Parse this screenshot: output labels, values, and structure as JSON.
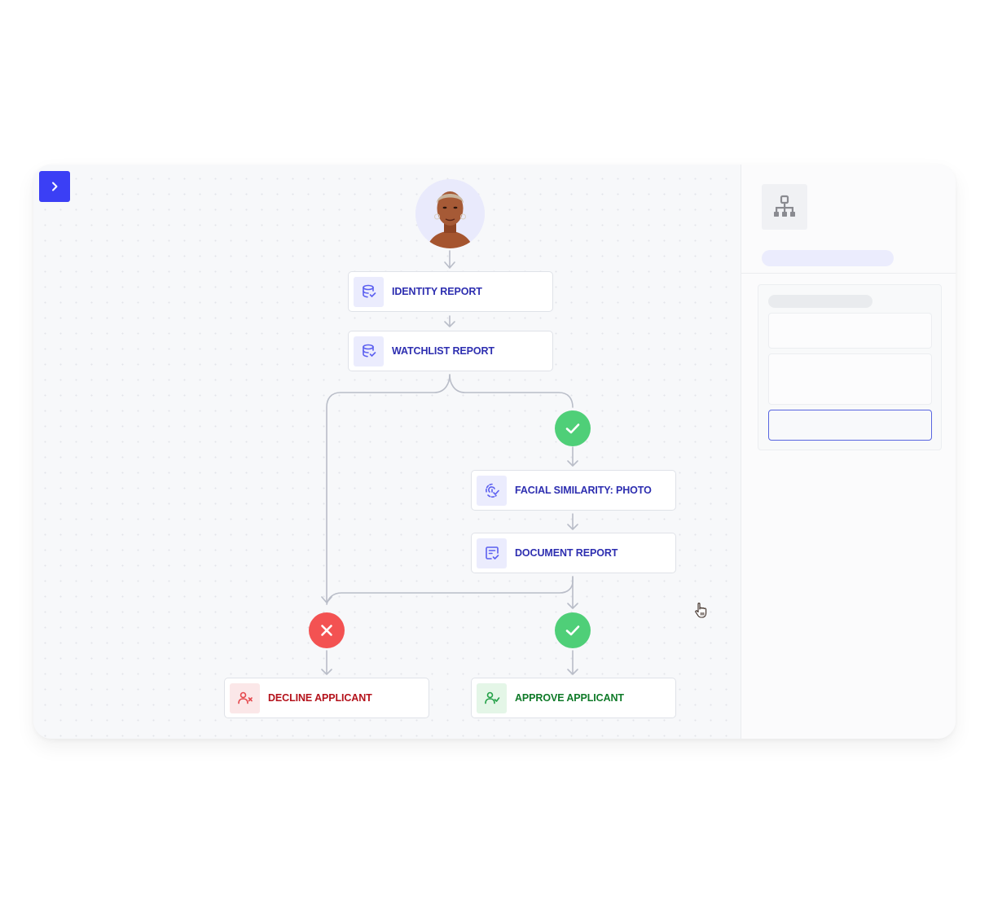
{
  "app": {
    "toggle_button": {
      "icon": "chevron-right-icon",
      "color": "#3b3ff5"
    }
  },
  "workflow": {
    "start": {
      "type": "applicant-avatar",
      "description": "applicant portrait photo"
    },
    "nodes": [
      {
        "id": "identity",
        "label": "IDENTITY REPORT",
        "icon": "database-check-icon",
        "variant": "task"
      },
      {
        "id": "watchlist",
        "label": "WATCHLIST REPORT",
        "icon": "database-check-icon",
        "variant": "task"
      },
      {
        "id": "facial",
        "label": "FACIAL SIMILARITY: PHOTO",
        "icon": "face-scan-check-icon",
        "variant": "task"
      },
      {
        "id": "document",
        "label": "DOCUMENT REPORT",
        "icon": "document-check-icon",
        "variant": "task"
      },
      {
        "id": "decline",
        "label": "DECLINE APPLICANT",
        "icon": "user-x-icon",
        "variant": "decline"
      },
      {
        "id": "approve",
        "label": "APPROVE APPLICANT",
        "icon": "user-check-icon",
        "variant": "approve"
      }
    ],
    "branch_status": [
      {
        "id": "watchlist-pass",
        "state": "pass",
        "icon": "check-icon"
      },
      {
        "id": "decline-outcome",
        "state": "fail",
        "icon": "x-icon"
      },
      {
        "id": "approve-outcome",
        "state": "pass",
        "icon": "check-icon"
      }
    ],
    "colors": {
      "task_text": "#2d2eb0",
      "task_icon_bg": "#ebecfd",
      "decline_text": "#b4121b",
      "decline_icon_bg": "#fbe7e8",
      "approve_text": "#0f7a28",
      "approve_icon_bg": "#e4f6e7",
      "pass": "#4fcf78",
      "fail": "#f35252",
      "edge": "#b9bdc8"
    }
  },
  "side_panel": {
    "icon": "workflow-hierarchy-icon",
    "title_placeholder": "",
    "fields": [
      {
        "name": "field-1",
        "value": ""
      },
      {
        "name": "field-2",
        "value": ""
      },
      {
        "name": "field-3",
        "value": "",
        "focused": true
      }
    ]
  },
  "cursor": {
    "type": "hand-pointer-icon"
  }
}
